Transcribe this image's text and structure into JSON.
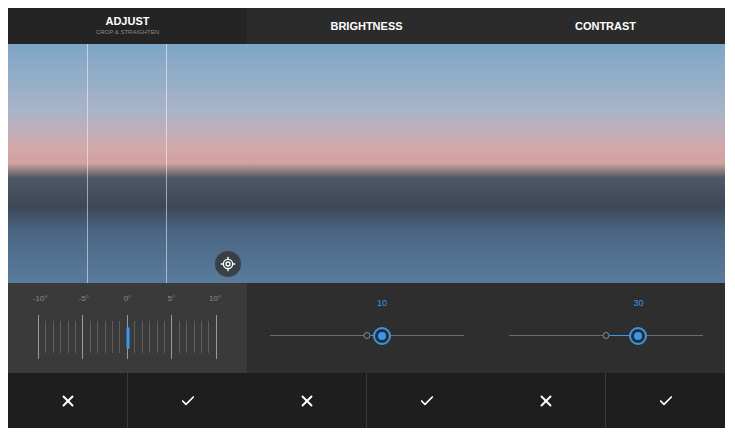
{
  "panels": [
    {
      "kind": "rotate",
      "title": "ADJUST",
      "subtitle": "CROP & STRAIGHTEN",
      "ticks": [
        "-10°",
        "-5°",
        "0°",
        "5°",
        "10°"
      ],
      "level": 0.5
    },
    {
      "kind": "slider",
      "title": "BRIGHTNESS",
      "reading": "10",
      "level": 0.58
    },
    {
      "kind": "slider",
      "title": "CONTRAST",
      "reading": "30",
      "level": 0.67
    }
  ]
}
